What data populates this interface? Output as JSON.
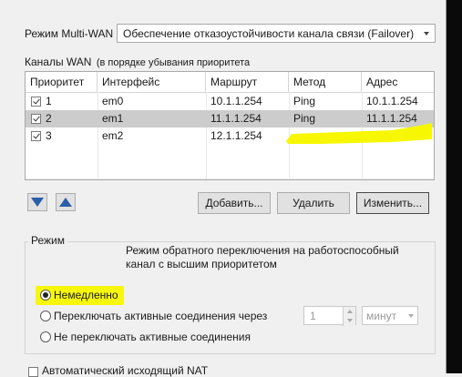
{
  "multiwan": {
    "label": "Режим Multi-WAN",
    "selected": "Обеспечение отказоустойчивости канала связи (Failover)"
  },
  "channels": {
    "label": "Каналы WAN",
    "hint": "(в порядке убывания приоритета"
  },
  "table": {
    "columns": [
      "Приоритет",
      "Интерфейс",
      "Маршрут",
      "Метод",
      "Адрес"
    ],
    "rows": [
      {
        "priority": "1",
        "iface": "em0",
        "route": "10.1.1.254",
        "method": "Ping",
        "address": "10.1.1.254",
        "checked": true,
        "selected": false
      },
      {
        "priority": "2",
        "iface": "em1",
        "route": "11.1.1.254",
        "method": "Ping",
        "address": "11.1.1.254",
        "checked": true,
        "selected": true
      },
      {
        "priority": "3",
        "iface": "em2",
        "route": "12.1.1.254",
        "method": "",
        "address": "",
        "checked": true,
        "selected": false
      }
    ]
  },
  "buttons": {
    "move_down_icon": "arrow-down-icon",
    "move_up_icon": "arrow-up-icon",
    "add": "Добавить...",
    "delete": "Удалить",
    "edit": "Изменить..."
  },
  "mode": {
    "group_title": "Режим",
    "description": "Режим обратного переключения на работоспособный канал с высшим приоритетом",
    "options": [
      "Немедленно",
      "Переключать активные соединения через",
      "Не переключать активные соединения"
    ],
    "selected_index": 0,
    "delay_value": "1",
    "delay_unit": "минут"
  },
  "nat": {
    "label": "Автоматический исходящий NAT"
  },
  "colors": {
    "highlight": "#f7f700",
    "selected_row": "#cccccc"
  }
}
